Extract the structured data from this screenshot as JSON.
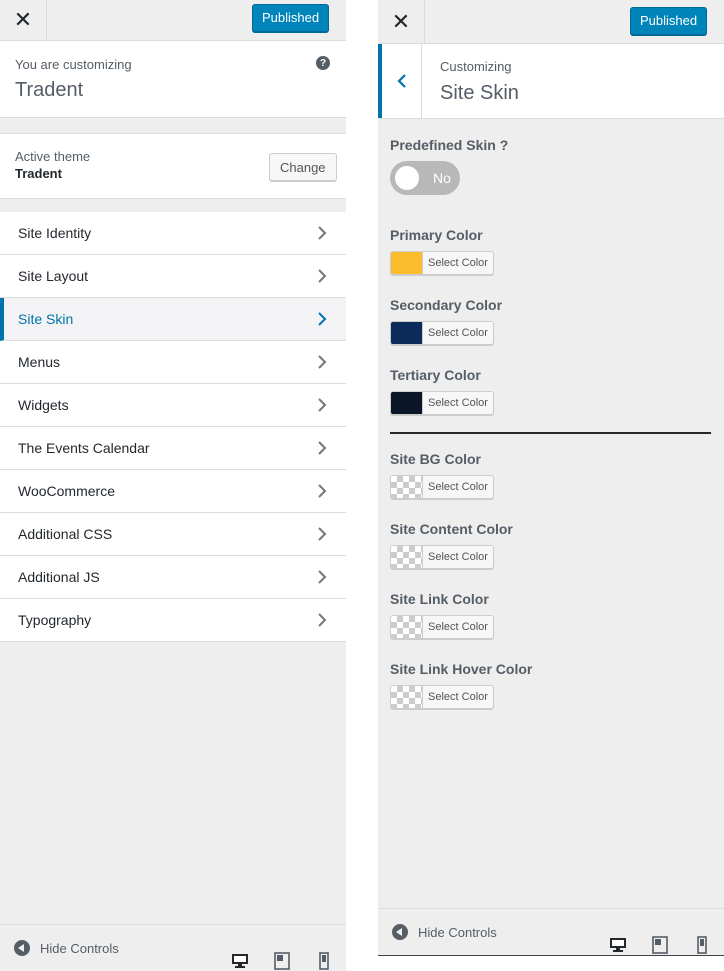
{
  "left": {
    "close_symbol": "✕",
    "publish_label": "Published",
    "customizing_label": "You are customizing",
    "theme_title": "Tradent",
    "help_symbol": "?",
    "active_theme_label": "Active theme",
    "active_theme_name": "Tradent",
    "change_label": "Change",
    "nav": [
      {
        "label": "Site Identity"
      },
      {
        "label": "Site Layout"
      },
      {
        "label": "Site Skin"
      },
      {
        "label": "Menus"
      },
      {
        "label": "Widgets"
      },
      {
        "label": "The Events Calendar"
      },
      {
        "label": "WooCommerce"
      },
      {
        "label": "Additional CSS"
      },
      {
        "label": "Additional JS"
      },
      {
        "label": "Typography"
      }
    ],
    "hide_controls": "Hide Controls"
  },
  "right": {
    "close_symbol": "✕",
    "publish_label": "Published",
    "customizing_label": "Customizing",
    "section_title": "Site Skin",
    "predefined_label": "Predefined Skin ?",
    "toggle_text": "No",
    "colors": [
      {
        "label": "Primary Color",
        "swatch": "#fbbc2e",
        "button": "Select Color"
      },
      {
        "label": "Secondary Color",
        "swatch": "#0c2b5b",
        "button": "Select Color"
      },
      {
        "label": "Tertiary Color",
        "swatch": "#0a1628",
        "button": "Select Color"
      },
      {
        "label": "Site BG Color",
        "swatch": "transparent",
        "button": "Select Color"
      },
      {
        "label": "Site Content Color",
        "swatch": "transparent",
        "button": "Select Color"
      },
      {
        "label": "Site Link Color",
        "swatch": "transparent",
        "button": "Select Color"
      },
      {
        "label": "Site Link Hover Color",
        "swatch": "transparent",
        "button": "Select Color"
      }
    ],
    "hide_controls": "Hide Controls"
  },
  "theme_colors": {
    "accent": "#0073aa",
    "primary_button": "#0085ba"
  }
}
